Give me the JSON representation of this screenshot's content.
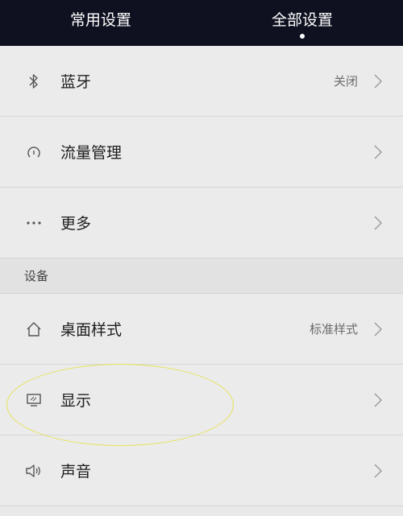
{
  "tabs": [
    {
      "label": "常用设置",
      "active": false
    },
    {
      "label": "全部设置",
      "active": true
    }
  ],
  "rows_top": [
    {
      "icon": "bluetooth-icon",
      "label": "蓝牙",
      "value": "关闭"
    },
    {
      "icon": "data-usage-icon",
      "label": "流量管理",
      "value": ""
    },
    {
      "icon": "more-dots-icon",
      "label": "更多",
      "value": ""
    }
  ],
  "section": {
    "title": "设备"
  },
  "rows_device": [
    {
      "icon": "home-icon",
      "label": "桌面样式",
      "value": "标准样式"
    },
    {
      "icon": "display-icon",
      "label": "显示",
      "value": ""
    },
    {
      "icon": "speaker-icon",
      "label": "声音",
      "value": ""
    }
  ],
  "colors": {
    "header_bg": "#0f1121",
    "list_bg": "#ebebeb",
    "highlight": "#e6e35a"
  }
}
